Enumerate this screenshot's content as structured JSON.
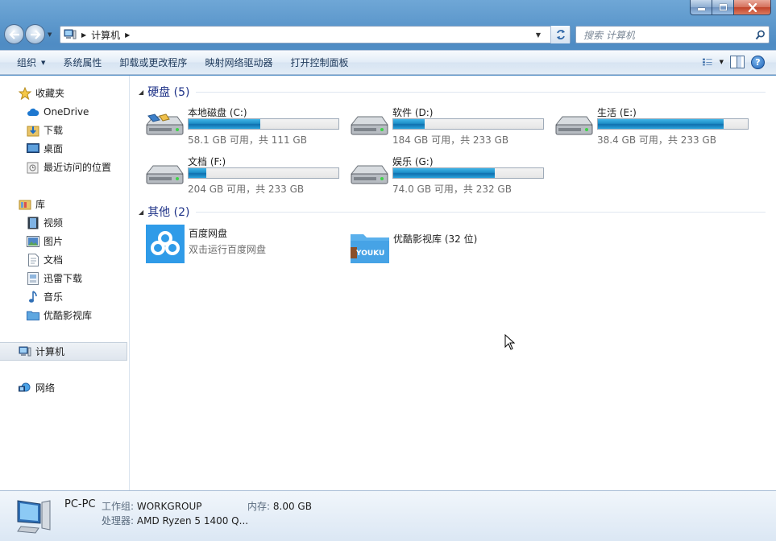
{
  "window": {
    "title": "计算机"
  },
  "nav": {
    "address_segment": "计算机",
    "search_placeholder": "搜索 计算机"
  },
  "toolbar": {
    "items": [
      "组织",
      "系统属性",
      "卸载或更改程序",
      "映射网络驱动器",
      "打开控制面板"
    ]
  },
  "sidebar": {
    "favorites": {
      "label": "收藏夹",
      "items": [
        "OneDrive",
        "下载",
        "桌面",
        "最近访问的位置"
      ]
    },
    "libraries": {
      "label": "库",
      "items": [
        "视频",
        "图片",
        "文档",
        "迅雷下载",
        "音乐",
        "优酷影视库"
      ]
    },
    "computer": "计算机",
    "network": "网络"
  },
  "content": {
    "hard_disks": {
      "title": "硬盘 (5)",
      "drives": [
        {
          "name": "本地磁盘 (C:)",
          "free": "58.1 GB 可用，共 111 GB",
          "used_fraction": 0.48
        },
        {
          "name": "软件 (D:)",
          "free": "184 GB 可用，共 233 GB",
          "used_fraction": 0.21
        },
        {
          "name": "生活 (E:)",
          "free": "38.4 GB 可用，共 233 GB",
          "used_fraction": 0.84
        },
        {
          "name": "文档 (F:)",
          "free": "204 GB 可用，共 233 GB",
          "used_fraction": 0.12
        },
        {
          "name": "娱乐 (G:)",
          "free": "74.0 GB 可用，共 232 GB",
          "used_fraction": 0.68
        }
      ]
    },
    "other": {
      "title": "其他 (2)",
      "items": [
        {
          "name": "百度网盘",
          "sub": "双击运行百度网盘"
        },
        {
          "name": "优酷影视库 (32 位)",
          "sub": ""
        }
      ],
      "youku_badge": "YOUKU"
    }
  },
  "details": {
    "name": "PC-PC",
    "workgroup_label": "工作组:",
    "workgroup": "WORKGROUP",
    "memory_label": "内存:",
    "memory": "8.00 GB",
    "cpu_label": "处理器:",
    "cpu": "AMD Ryzen 5 1400 Q..."
  },
  "colors": {
    "accent": "#1e8fc8",
    "section_title": "#1e3287"
  }
}
